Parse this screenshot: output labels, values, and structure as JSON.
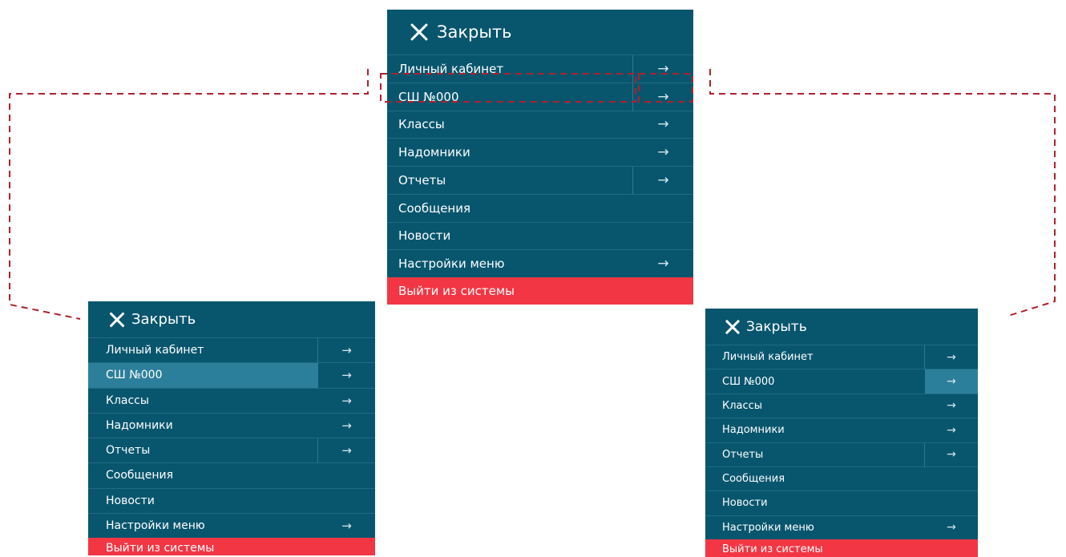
{
  "colors": {
    "menu_bg": "#08566e",
    "highlight": "#2c7f9a",
    "logout_bg": "#f23644",
    "callout": "#b0212b"
  },
  "menus": [
    {
      "id": "center",
      "close_label": "Закрыть",
      "items": [
        {
          "label": "Личный кабинет",
          "arrow": "→",
          "highlight": "none"
        },
        {
          "label": "СШ №000",
          "arrow": "→",
          "highlight": "none"
        },
        {
          "label": "Классы",
          "arrow": "→",
          "highlight": "none"
        },
        {
          "label": "Надомники",
          "arrow": "→",
          "highlight": "none"
        },
        {
          "label": "Отчеты",
          "arrow": "→",
          "highlight": "none"
        },
        {
          "label": "Сообщения",
          "arrow": "",
          "highlight": "none"
        },
        {
          "label": "Новости",
          "arrow": "",
          "highlight": "none"
        },
        {
          "label": "Настройки меню",
          "arrow": "→",
          "highlight": "none"
        }
      ],
      "logout_label": "Выйти из системы"
    },
    {
      "id": "left",
      "close_label": "Закрыть",
      "items": [
        {
          "label": "Личный кабинет",
          "arrow": "→",
          "highlight": "none"
        },
        {
          "label": "СШ №000",
          "arrow": "→",
          "highlight": "label"
        },
        {
          "label": "Классы",
          "arrow": "→",
          "highlight": "none"
        },
        {
          "label": "Надомники",
          "arrow": "→",
          "highlight": "none"
        },
        {
          "label": "Отчеты",
          "arrow": "→",
          "highlight": "none"
        },
        {
          "label": "Сообщения",
          "arrow": "",
          "highlight": "none"
        },
        {
          "label": "Новости",
          "arrow": "",
          "highlight": "none"
        },
        {
          "label": "Настройки меню",
          "arrow": "→",
          "highlight": "none"
        }
      ],
      "logout_label": "Выйти из системы"
    },
    {
      "id": "right",
      "close_label": "Закрыть",
      "items": [
        {
          "label": "Личный кабинет",
          "arrow": "→",
          "highlight": "none"
        },
        {
          "label": "СШ №000",
          "arrow": "→",
          "highlight": "arrow"
        },
        {
          "label": "Классы",
          "arrow": "→",
          "highlight": "none"
        },
        {
          "label": "Надомники",
          "arrow": "→",
          "highlight": "none"
        },
        {
          "label": "Отчеты",
          "arrow": "→",
          "highlight": "none"
        },
        {
          "label": "Сообщения",
          "arrow": "",
          "highlight": "none"
        },
        {
          "label": "Новости",
          "arrow": "",
          "highlight": "none"
        },
        {
          "label": "Настройки меню",
          "arrow": "→",
          "highlight": "none"
        }
      ],
      "logout_label": "Выйти из системы"
    }
  ]
}
